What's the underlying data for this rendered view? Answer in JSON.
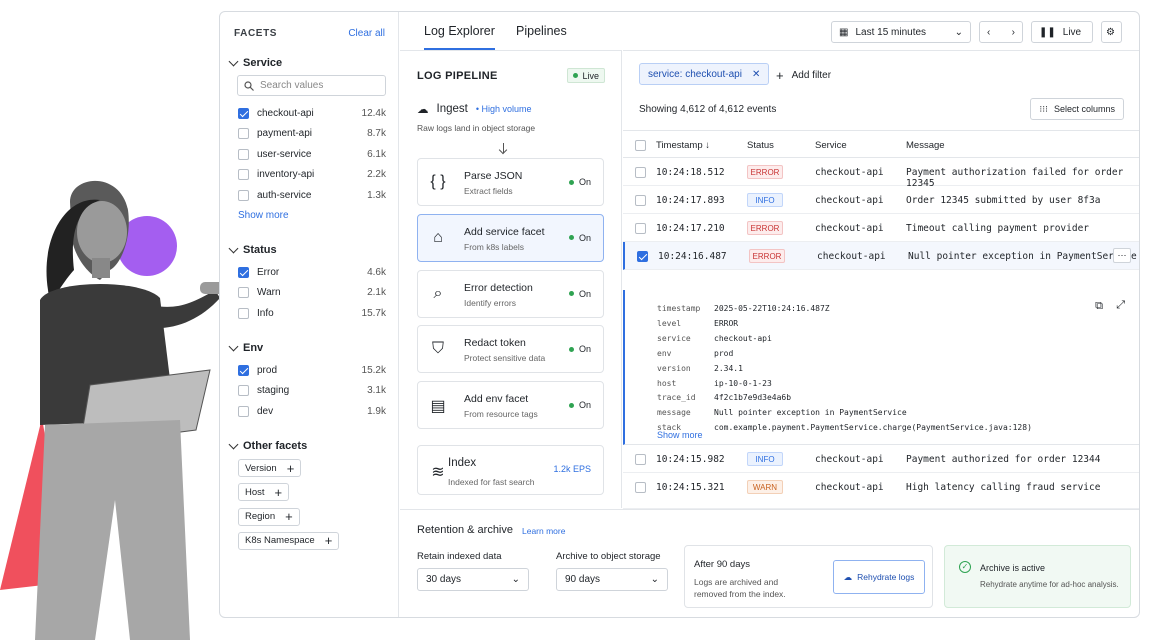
{
  "facets": {
    "heading": "FACETS",
    "clear": "Clear all",
    "service": {
      "title": "Service",
      "search_placeholder": "Search values",
      "items": [
        {
          "label": "checkout-api",
          "count": "12.4k",
          "checked": true
        },
        {
          "label": "payment-api",
          "count": "8.7k"
        },
        {
          "label": "user-service",
          "count": "6.1k"
        },
        {
          "label": "inventory-api",
          "count": "2.2k"
        },
        {
          "label": "auth-service",
          "count": "1.3k"
        }
      ],
      "more": "Show more"
    },
    "status": {
      "title": "Status",
      "items": [
        {
          "label": "Error",
          "count": "4.6k",
          "checked": true
        },
        {
          "label": "Warn",
          "count": "2.1k"
        },
        {
          "label": "Info",
          "count": "15.7k"
        }
      ]
    },
    "env": {
      "title": "Env",
      "items": [
        {
          "label": "prod",
          "count": "15.2k",
          "checked": true
        },
        {
          "label": "staging",
          "count": "3.1k"
        },
        {
          "label": "dev",
          "count": "1.9k"
        }
      ]
    },
    "other": {
      "title": "Other facets",
      "chips": [
        "Version",
        "Host",
        "Region",
        "K8s Namespace"
      ]
    }
  },
  "tabs": [
    "Log Explorer",
    "Pipelines"
  ],
  "toolbar": {
    "time_range": "Last 15 minutes",
    "live": "Live"
  },
  "pipeline": {
    "title": "LOG PIPELINE",
    "live": "Live",
    "ingest": {
      "title": "Ingest",
      "badge": "High volume",
      "sub": "Raw logs land in object storage"
    },
    "steps": [
      {
        "title": "Parse JSON",
        "sub": "Extract fields",
        "status": "On",
        "icon": "braces-icon"
      },
      {
        "title": "Add service facet",
        "sub": "From k8s labels",
        "status": "On",
        "icon": "tag-icon"
      },
      {
        "title": "Error detection",
        "sub": "Identify errors",
        "status": "On",
        "icon": "search-icon"
      },
      {
        "title": "Redact token",
        "sub": "Protect sensitive data",
        "status": "On",
        "icon": "shield-lock-icon"
      },
      {
        "title": "Add env facet",
        "sub": "From resource tags",
        "status": "On",
        "icon": "document-icon"
      }
    ],
    "index": {
      "title": "Index",
      "sub": "Indexed for fast search",
      "rate": "1.2k EPS"
    }
  },
  "events": {
    "filter": "service: checkout-api",
    "add_filter": "Add filter",
    "showing": "Showing 4,612 of 4,612 events",
    "select_columns": "Select columns",
    "columns": [
      "Timestamp",
      "Status",
      "Service",
      "Message"
    ],
    "rows": [
      {
        "ts": "10:24:18.512",
        "status": "ERROR",
        "service": "checkout-api",
        "msg": "Payment authorization failed for order 12345"
      },
      {
        "ts": "10:24:17.893",
        "status": "INFO",
        "service": "checkout-api",
        "msg": "Order 12345 submitted by user 8f3a"
      },
      {
        "ts": "10:24:17.210",
        "status": "ERROR",
        "service": "checkout-api",
        "msg": "Timeout calling payment provider"
      },
      {
        "ts": "10:24:16.487",
        "status": "ERROR",
        "service": "checkout-api",
        "msg": "Null pointer exception in PaymentService"
      },
      {
        "ts": "10:24:15.982",
        "status": "INFO",
        "service": "checkout-api",
        "msg": "Payment authorized for order 12344"
      },
      {
        "ts": "10:24:15.321",
        "status": "WARN",
        "service": "checkout-api",
        "msg": "High latency calling fraud service"
      }
    ],
    "detail": [
      [
        "timestamp",
        "2025-05-22T10:24:16.487Z"
      ],
      [
        "level",
        "ERROR"
      ],
      [
        "service",
        "checkout-api"
      ],
      [
        "env",
        "prod"
      ],
      [
        "version",
        "2.34.1"
      ],
      [
        "host",
        "ip-10-0-1-23"
      ],
      [
        "trace_id",
        "4f2c1b7e9d3e4a6b"
      ],
      [
        "message",
        "Null pointer exception in PaymentService"
      ],
      [
        "stack",
        "com.example.payment.PaymentService.charge(PaymentService.java:128)"
      ]
    ],
    "show_more": "Show more"
  },
  "retention": {
    "title": "Retention & archive",
    "learn": "Learn more",
    "retain_label": "Retain indexed data",
    "retain_value": "30 days",
    "archive_label": "Archive to object storage",
    "archive_value": "90 days",
    "after_title": "After 90 days",
    "after_text1": "Logs are archived and",
    "after_text2": "removed from the index.",
    "rehydrate": "Rehydrate logs",
    "active_title": "Archive is active",
    "active_text": "Rehydrate anytime for ad-hoc analysis."
  },
  "colors": {
    "accent": "#2f6fe0",
    "error": "#c83535",
    "warn": "#c8611f",
    "ok": "#2fa352"
  }
}
